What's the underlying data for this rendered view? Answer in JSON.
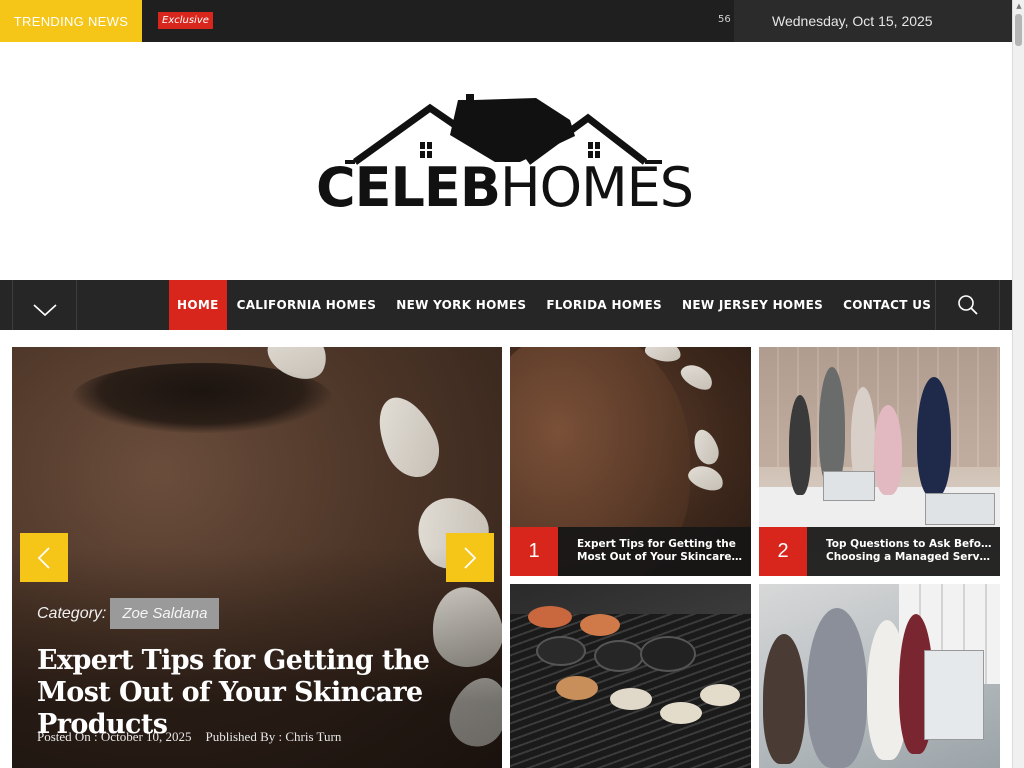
{
  "topbar": {
    "trending_label": "TRENDING NEWS",
    "badge": "Exclusive",
    "count": "56",
    "date": "Wednesday, Oct 15, 2025"
  },
  "logo": {
    "bold_part": "CELEB",
    "light_part": "HOMES"
  },
  "nav": {
    "items": [
      {
        "label": "HOME",
        "active": true
      },
      {
        "label": "CALIFORNIA HOMES"
      },
      {
        "label": "NEW YORK HOMES"
      },
      {
        "label": "FLORIDA HOMES"
      },
      {
        "label": "NEW JERSEY HOMES"
      },
      {
        "label": "CONTACT US"
      }
    ]
  },
  "hero": {
    "category_label": "Category:",
    "category": "Zoe Saldana",
    "title": "Expert Tips for Getting the Most Out of Your Skincare Products",
    "posted_on": "Posted On : October 10, 2025",
    "published_by": "Published By : Chris Turn"
  },
  "cards": [
    {
      "number": "1",
      "title_line1": "Expert Tips for Getting the",
      "title_line2": "Most Out of Your Skincare..."
    },
    {
      "number": "2",
      "title_line1": "Top Questions to Ask Before",
      "title_line2": "Choosing a Managed Servic..."
    }
  ],
  "icons": {
    "nav_toggle": "chevron-down-icon",
    "search": "search-icon",
    "prev": "chevron-left-icon",
    "next": "chevron-right-icon"
  },
  "colors": {
    "accent_yellow": "#f5c518",
    "accent_red": "#d9261c",
    "dark": "#262626"
  }
}
